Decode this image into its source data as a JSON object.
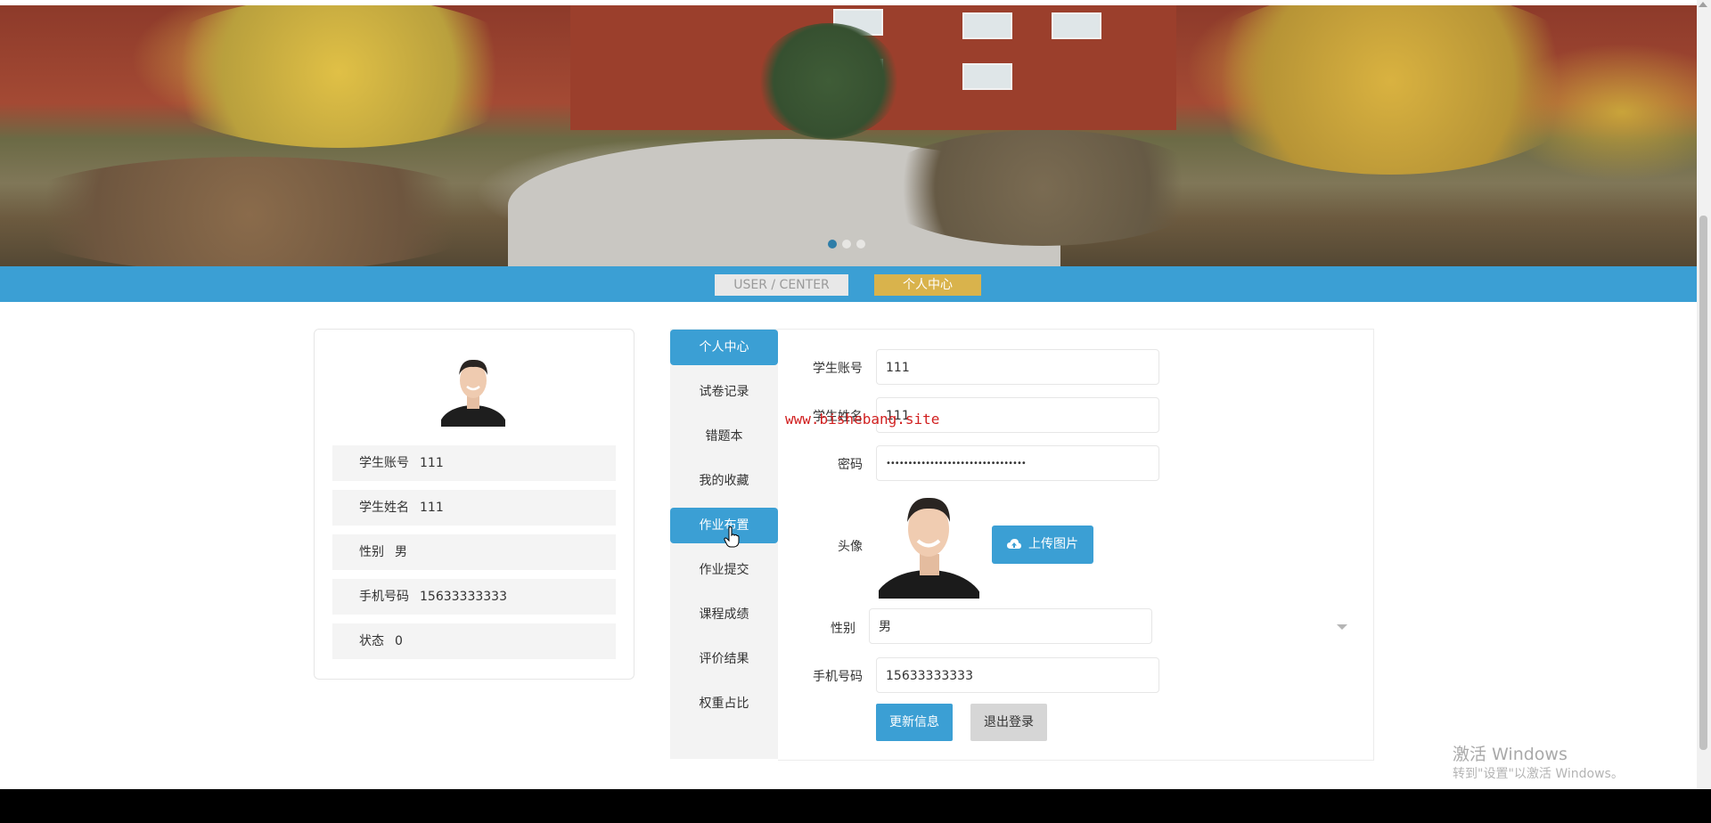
{
  "banner": {
    "slide_dots": [
      {
        "active": true
      },
      {
        "active": false
      },
      {
        "active": false
      }
    ]
  },
  "title_bar": {
    "en": "USER / CENTER",
    "cn": "个人中心"
  },
  "profile": {
    "rows": [
      {
        "label": "学生账号",
        "value": "111"
      },
      {
        "label": "学生姓名",
        "value": "111"
      },
      {
        "label": "性别",
        "value": "男"
      },
      {
        "label": "手机号码",
        "value": "15633333333"
      },
      {
        "label": "状态",
        "value": "0"
      }
    ]
  },
  "menu": {
    "items": [
      {
        "label": "个人中心",
        "active": true
      },
      {
        "label": "试卷记录",
        "active": false
      },
      {
        "label": "错题本",
        "active": false
      },
      {
        "label": "我的收藏",
        "active": false
      },
      {
        "label": "作业布置",
        "active": true
      },
      {
        "label": "作业提交",
        "active": false
      },
      {
        "label": "课程成绩",
        "active": false
      },
      {
        "label": "评价结果",
        "active": false
      },
      {
        "label": "权重占比",
        "active": false
      }
    ]
  },
  "form": {
    "account_label": "学生账号",
    "account_value": "111",
    "name_label": "学生姓名",
    "name_value": "111",
    "password_label": "密码",
    "password_value": "••••••••••••••••••••••••••••••••",
    "avatar_label": "头像",
    "upload_label": "上传图片",
    "gender_label": "性别",
    "gender_value": "男",
    "phone_label": "手机号码",
    "phone_value": "15633333333",
    "update_label": "更新信息",
    "logout_label": "退出登录"
  },
  "watermark": "www.bishebang.site",
  "windows": {
    "title": "激活 Windows",
    "subtitle": "转到\"设置\"以激活 Windows。"
  },
  "colors": {
    "primary": "#3b9fd4",
    "gold": "#d9b34c",
    "watermark": "#d11f1f"
  }
}
